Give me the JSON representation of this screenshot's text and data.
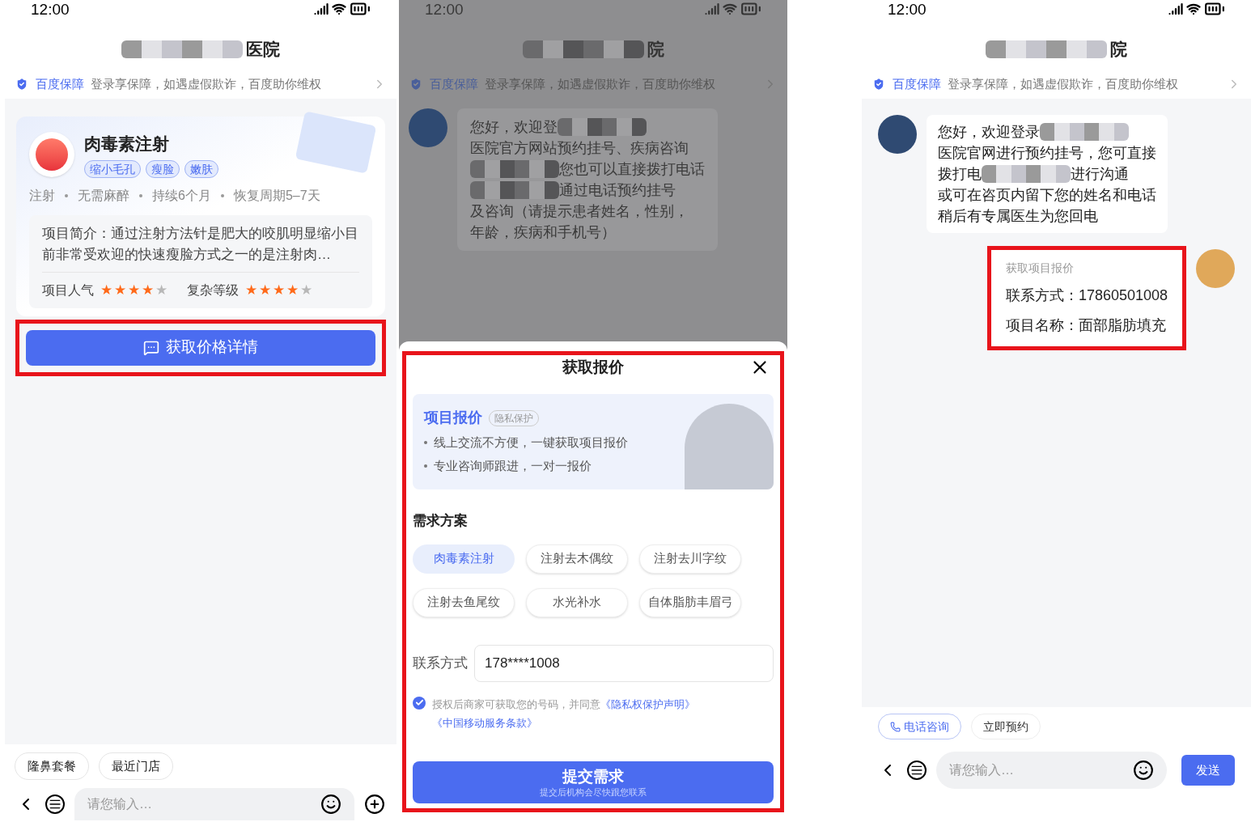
{
  "product_screen": {
    "status_bar": {
      "time": "12:00"
    },
    "header": {
      "title": "医院"
    },
    "guarantee_banner": {
      "brand": "百度保障",
      "text": "登录享保障，如遇虚假欺诈，百度助你维权"
    },
    "product_card": {
      "name": "肉毒素注射",
      "tags": [
        "缩小毛孔",
        "瘦脸",
        "嫩肤"
      ],
      "attributes": [
        "注射",
        "无需麻醉",
        "持续6个月",
        "恢复周期5–7天"
      ],
      "intro": "项目简介：通过注射方法针是肥大的咬肌明显缩小目前非常受欢迎的快速瘦脸方式之一的是注射肉…",
      "ratings": [
        {
          "label": "项目人气",
          "stars": 4
        },
        {
          "label": "复杂等级",
          "stars": 4
        }
      ]
    },
    "action_button": {
      "label": "获取价格详情",
      "highlighted": true
    },
    "quick_replies": [
      "隆鼻套餐",
      "最近门店"
    ],
    "input": {
      "placeholder": "请您输入…"
    }
  },
  "quote_screen": {
    "status_bar": {
      "time": "12:00"
    },
    "header": {
      "title": "院"
    },
    "guarantee_banner": {
      "brand": "百度保障",
      "text": "登录享保障，如遇虚假欺诈，百度助你维权"
    },
    "message_lines": [
      [
        {
          "kind": "text",
          "text": "您好，欢迎登"
        },
        {
          "kind": "redacted"
        }
      ],
      [
        {
          "kind": "text",
          "text": "医院官方网站预约挂号、疾病咨询"
        }
      ],
      [
        {
          "kind": "redacted"
        },
        {
          "kind": "text",
          "text": "您也可以直接拨打电话"
        }
      ],
      [
        {
          "kind": "redacted"
        },
        {
          "kind": "text",
          "text": "通过电话预约挂号"
        }
      ],
      [
        {
          "kind": "text",
          "text": "及咨询（请提示患者姓名，性别，"
        }
      ],
      [
        {
          "kind": "text",
          "text": "年龄，疾病和手机号）"
        }
      ]
    ],
    "modal": {
      "title": "获取报价",
      "highlighted": true,
      "promo": {
        "title": "项目报价",
        "badge": "隐私保护",
        "bullets": [
          "线上交流不方便，一键获取项目报价",
          "专业咨询师跟进，一对一报价"
        ]
      },
      "section_title": "需求方案",
      "options": [
        {
          "label": "肉毒素注射",
          "selected": true
        },
        {
          "label": "注射去木偶纹",
          "selected": false
        },
        {
          "label": "注射去川字纹",
          "selected": false
        },
        {
          "label": "注射去鱼尾纹",
          "selected": false
        },
        {
          "label": "水光补水",
          "selected": false
        },
        {
          "label": "自体脂肪丰眉弓",
          "selected": false
        }
      ],
      "contact": {
        "label": "联系方式",
        "value": "178****1008"
      },
      "consent": {
        "checked": true,
        "text": "授权后商家可获取您的号码，并同意",
        "links": [
          "《隐私权保护声明》",
          "《中国移动服务条款》"
        ]
      },
      "submit": {
        "label": "提交需求",
        "sublabel": "提交后机构会尽快跟您联系"
      }
    }
  },
  "chat_screen": {
    "status_bar": {
      "time": "12:00"
    },
    "header": {
      "title": "院"
    },
    "guarantee_banner": {
      "brand": "百度保障",
      "text": "登录享保障，如遇虚假欺诈，百度助你维权"
    },
    "message_lines": [
      [
        {
          "kind": "text",
          "text": "您好，欢迎登录"
        },
        {
          "kind": "redacted"
        }
      ],
      [
        {
          "kind": "text",
          "text": "医院官网进行预约挂号，您可直接"
        }
      ],
      [
        {
          "kind": "text",
          "text": "拨打电"
        },
        {
          "kind": "redacted"
        },
        {
          "kind": "text",
          "text": "进行沟通"
        }
      ],
      [
        {
          "kind": "text",
          "text": "或可在咨页内留下您的姓名和电话"
        }
      ],
      [
        {
          "kind": "text",
          "text": "稍后有专属医生为您回电"
        }
      ]
    ],
    "quote_card": {
      "title": "获取项目报价",
      "lines": [
        "联系方式：17860501008",
        "项目名称：面部脂肪填充"
      ],
      "highlighted": true
    },
    "quick_replies": [
      {
        "label": "电话咨询",
        "kind": "phone"
      },
      {
        "label": "立即预约",
        "kind": "plain"
      }
    ],
    "input": {
      "placeholder": "请您输入…"
    },
    "send_button": "发送"
  }
}
